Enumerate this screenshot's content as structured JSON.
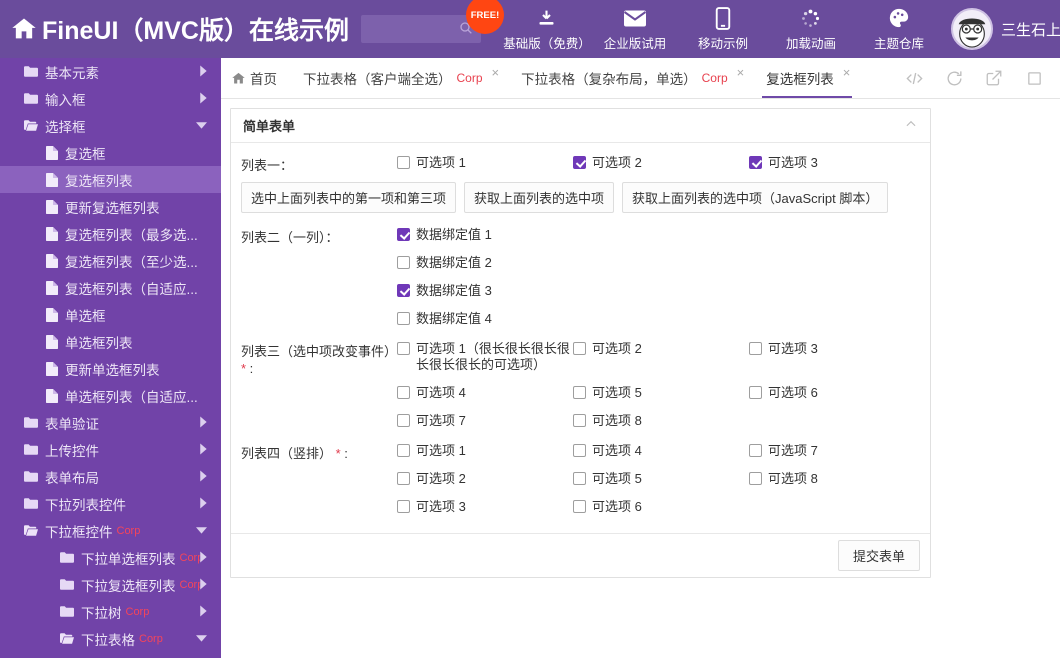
{
  "header": {
    "home_icon": "home-icon",
    "brand_title": "FineUI（MVC版）在线示例",
    "search": {
      "value": "",
      "placeholder": "",
      "icon": "search-icon"
    },
    "free_badge": "FREE!",
    "tools": [
      {
        "icon": "download-icon",
        "label": "基础版（免费）"
      },
      {
        "icon": "envelope-icon",
        "label": "企业版试用"
      },
      {
        "icon": "mobile-icon",
        "label": "移动示例"
      },
      {
        "icon": "spinner-icon",
        "label": "加载动画"
      },
      {
        "icon": "palette-icon",
        "label": "主题仓库"
      }
    ],
    "user": {
      "avatar": "user-avatar",
      "name": "三生石上",
      "caret": "▼"
    }
  },
  "sidebar": {
    "items": [
      {
        "label": "基本元素",
        "level": 1,
        "icon": "folder-icon",
        "arrow": "right",
        "selected": false,
        "corp": ""
      },
      {
        "label": "输入框",
        "level": 1,
        "icon": "folder-icon",
        "arrow": "right",
        "selected": false,
        "corp": ""
      },
      {
        "label": "选择框",
        "level": 1,
        "icon": "folder-open-icon",
        "arrow": "down",
        "selected": false,
        "corp": ""
      },
      {
        "label": "复选框",
        "level": 2,
        "icon": "file-icon",
        "arrow": "",
        "selected": false,
        "corp": ""
      },
      {
        "label": "复选框列表",
        "level": 2,
        "icon": "file-icon",
        "arrow": "",
        "selected": true,
        "corp": ""
      },
      {
        "label": "更新复选框列表",
        "level": 2,
        "icon": "file-icon",
        "arrow": "",
        "selected": false,
        "corp": ""
      },
      {
        "label": "复选框列表（最多选...",
        "level": 2,
        "icon": "file-icon",
        "arrow": "",
        "selected": false,
        "corp": ""
      },
      {
        "label": "复选框列表（至少选...",
        "level": 2,
        "icon": "file-icon",
        "arrow": "",
        "selected": false,
        "corp": ""
      },
      {
        "label": "复选框列表（自适应...",
        "level": 2,
        "icon": "file-icon",
        "arrow": "",
        "selected": false,
        "corp": ""
      },
      {
        "label": "单选框",
        "level": 2,
        "icon": "file-icon",
        "arrow": "",
        "selected": false,
        "corp": ""
      },
      {
        "label": "单选框列表",
        "level": 2,
        "icon": "file-icon",
        "arrow": "",
        "selected": false,
        "corp": ""
      },
      {
        "label": "更新单选框列表",
        "level": 2,
        "icon": "file-icon",
        "arrow": "",
        "selected": false,
        "corp": ""
      },
      {
        "label": "单选框列表（自适应...",
        "level": 2,
        "icon": "file-icon",
        "arrow": "",
        "selected": false,
        "corp": ""
      },
      {
        "label": "表单验证",
        "level": 1,
        "icon": "folder-icon",
        "arrow": "right",
        "selected": false,
        "corp": ""
      },
      {
        "label": "上传控件",
        "level": 1,
        "icon": "folder-icon",
        "arrow": "right",
        "selected": false,
        "corp": ""
      },
      {
        "label": "表单布局",
        "level": 1,
        "icon": "folder-icon",
        "arrow": "right",
        "selected": false,
        "corp": ""
      },
      {
        "label": "下拉列表控件",
        "level": 1,
        "icon": "folder-icon",
        "arrow": "right",
        "selected": false,
        "corp": ""
      },
      {
        "label": "下拉框控件",
        "level": 1,
        "icon": "folder-open-icon",
        "arrow": "down",
        "selected": false,
        "corp": "Corp"
      },
      {
        "label": "下拉单选框列表",
        "level": 3,
        "icon": "folder-icon",
        "arrow": "right",
        "selected": false,
        "corp": "Corp"
      },
      {
        "label": "下拉复选框列表",
        "level": 3,
        "icon": "folder-icon",
        "arrow": "right",
        "selected": false,
        "corp": "Corp"
      },
      {
        "label": "下拉树",
        "level": 3,
        "icon": "folder-icon",
        "arrow": "right",
        "selected": false,
        "corp": "Corp"
      },
      {
        "label": "下拉表格",
        "level": 3,
        "icon": "folder-open-icon",
        "arrow": "down",
        "selected": false,
        "corp": "Corp"
      }
    ]
  },
  "tabs": [
    {
      "label": "首页",
      "icon": "home-icon",
      "closable": false,
      "active": false,
      "corp": ""
    },
    {
      "label": "下拉表格（客户端全选）",
      "icon": "",
      "closable": true,
      "active": false,
      "corp": "Corp"
    },
    {
      "label": "下拉表格（复杂布局，单选）",
      "icon": "",
      "closable": true,
      "active": false,
      "corp": "Corp"
    },
    {
      "label": "复选框列表",
      "icon": "",
      "closable": true,
      "active": true,
      "corp": ""
    }
  ],
  "tab_tools": [
    {
      "icon": "code-icon"
    },
    {
      "icon": "refresh-icon"
    },
    {
      "icon": "external-link-icon"
    },
    {
      "icon": "maximize-icon"
    }
  ],
  "panel": {
    "title": "简单表单",
    "collapse_icon": "chevron-up-icon",
    "submit_label": "提交表单",
    "groups": [
      {
        "id": "list-one",
        "label": "列表一：",
        "required": false,
        "layout": "horizontal",
        "options": [
          {
            "label": "可选项 1",
            "checked": false
          },
          {
            "label": "可选项 2",
            "checked": true
          },
          {
            "label": "可选项 3",
            "checked": true
          }
        ],
        "buttons": [
          "选中上面列表中的第一项和第三项",
          "获取上面列表的选中项",
          "获取上面列表的选中项（JavaScript 脚本）"
        ]
      },
      {
        "id": "list-two",
        "label": "列表二（一列）：",
        "required": false,
        "layout": "single-column",
        "options": [
          {
            "label": "数据绑定值 1",
            "checked": true
          },
          {
            "label": "数据绑定值 2",
            "checked": false
          },
          {
            "label": "数据绑定值 3",
            "checked": true
          },
          {
            "label": "数据绑定值 4",
            "checked": false
          }
        ],
        "buttons": []
      },
      {
        "id": "list-three",
        "label": "列表三（选中项改变事件）",
        "required": true,
        "layout": "grid-row-major",
        "options": [
          {
            "label": "可选项 1（很长很长很长很长很长很长的可选项）",
            "checked": false
          },
          {
            "label": "可选项 2",
            "checked": false
          },
          {
            "label": "可选项 3",
            "checked": false
          },
          {
            "label": "可选项 4",
            "checked": false
          },
          {
            "label": "可选项 5",
            "checked": false
          },
          {
            "label": "可选项 6",
            "checked": false
          },
          {
            "label": "可选项 7",
            "checked": false
          },
          {
            "label": "可选项 8",
            "checked": false
          }
        ],
        "buttons": []
      },
      {
        "id": "list-four",
        "label": "列表四（竖排）",
        "required": true,
        "layout": "grid-column-major",
        "columns": [
          [
            {
              "label": "可选项 1",
              "checked": false
            },
            {
              "label": "可选项 2",
              "checked": false
            },
            {
              "label": "可选项 3",
              "checked": false
            }
          ],
          [
            {
              "label": "可选项 4",
              "checked": false
            },
            {
              "label": "可选项 5",
              "checked": false
            },
            {
              "label": "可选项 6",
              "checked": false
            }
          ],
          [
            {
              "label": "可选项 7",
              "checked": false
            },
            {
              "label": "可选项 8",
              "checked": false
            }
          ]
        ],
        "buttons": []
      }
    ]
  }
}
